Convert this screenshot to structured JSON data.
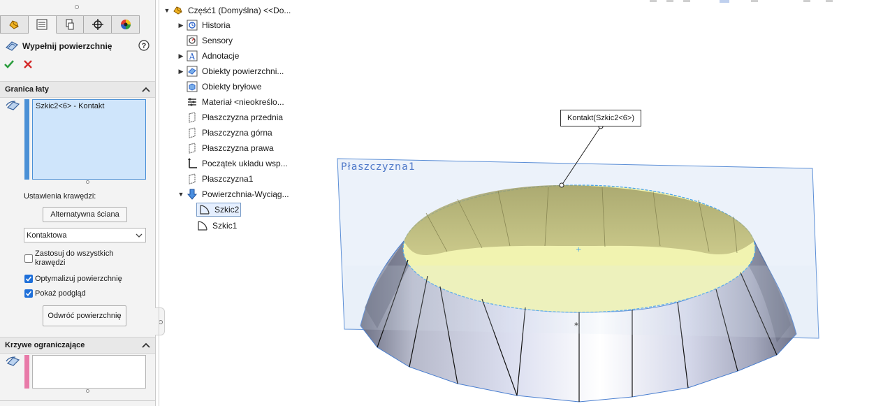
{
  "property_manager": {
    "title": "Wypełnij powierzchnię",
    "tabs": [
      "feature-manager",
      "property-manager",
      "configuration-manager",
      "dimxpert-manager",
      "display-manager"
    ],
    "patch_boundary": {
      "title": "Granica łaty",
      "list_item": "Szkic2<6> - Kontakt",
      "edge_settings_label": "Ustawienia krawędzi:",
      "alt_face_button": "Alternatywna ściana",
      "condition_value": "Kontaktowa",
      "apply_all_label": "Zastosuj do wszystkich krawędzi",
      "apply_all_checked": false,
      "optimize_label": "Optymalizuj powierzchnię",
      "optimize_checked": true,
      "preview_label": "Pokaż podgląd",
      "preview_checked": true,
      "reverse_button": "Odwróć powierzchnię"
    },
    "constraint_curves": {
      "title": "Krzywe ograniczające"
    }
  },
  "feature_tree": {
    "root": "Część1 (Domyślna) <<Do...",
    "items": [
      {
        "label": "Historia",
        "icon": "history-icon",
        "expandable": true
      },
      {
        "label": "Sensory",
        "icon": "sensor-icon",
        "expandable": false
      },
      {
        "label": "Adnotacje",
        "icon": "annotation-icon",
        "expandable": true
      },
      {
        "label": "Obiekty powierzchni...",
        "icon": "surface-bodies-icon",
        "expandable": true
      },
      {
        "label": "Obiekty bryłowe",
        "icon": "solid-bodies-icon",
        "expandable": false
      },
      {
        "label": "Materiał <nieokreślo...",
        "icon": "material-icon",
        "expandable": false
      },
      {
        "label": "Płaszczyzna przednia",
        "icon": "plane-icon",
        "expandable": false
      },
      {
        "label": "Płaszczyzna górna",
        "icon": "plane-icon",
        "expandable": false
      },
      {
        "label": "Płaszczyzna prawa",
        "icon": "plane-icon",
        "expandable": false
      },
      {
        "label": "Początek układu wsp...",
        "icon": "origin-icon",
        "expandable": false
      },
      {
        "label": "Płaszczyzna1",
        "icon": "plane-icon",
        "expandable": false
      },
      {
        "label": "Powierzchnia-Wyciąg...",
        "icon": "extrude-surface-icon",
        "expandable": true,
        "expanded": true
      }
    ],
    "children": [
      {
        "label": "Szkic2",
        "icon": "sketch-icon",
        "selected": true
      },
      {
        "label": "Szkic1",
        "icon": "sketch-icon",
        "selected": false
      }
    ]
  },
  "viewport": {
    "plane_label": "Płaszczyzna1",
    "callout": "Kontakt(Szkic2<6>)"
  },
  "colors": {
    "accent": "#1e6fd9",
    "selection_fill": "#cfe5fb",
    "patch_fill": "#f1f3b0",
    "plane_fill": "#dce8f6",
    "plane_border": "#5b8ed6"
  }
}
